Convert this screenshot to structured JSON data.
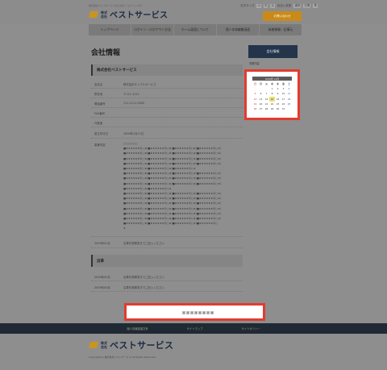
{
  "header": {
    "tagline": "株式会社ベストサービスの公式ホームページです",
    "logo_small": "株式会社",
    "logo_text": "ベストサービス",
    "util_label": "文字サイズ",
    "util_sizes": [
      "小",
      "中",
      "大"
    ],
    "util_print": "色合い変更",
    "util_colors": [
      "通常",
      "白黒",
      "青"
    ],
    "inquiry_button": "お問い合わせ"
  },
  "nav": {
    "items": [
      "トップページ",
      "ログイン・ログアウト方法",
      "ホーム画面について",
      "個人本体編集画面",
      "新着情報・記事元"
    ]
  },
  "main": {
    "page_title": "会社情報",
    "company_heading": "株式会社ベストサービス",
    "rows": [
      {
        "label": "会社名",
        "value": "株式会社サンプルサービス"
      },
      {
        "label": "所在地",
        "value": "〒111-1111"
      },
      {
        "label": "電話番号",
        "value": "111-1111-0000"
      },
      {
        "label": "FAX番号",
        "value": ""
      },
      {
        "label": "代表者",
        "value": ""
      },
      {
        "label": "設立年月日",
        "value": "2009年1月11日"
      }
    ],
    "business_label": "事業内容",
    "business_lines": [
      "□□□□□□",
      "■★★★★★★の□★/■★★★★★★の□★/■★★★★★★の□★/■★★★★★★の□★/",
      "■★★★★★★の□★/■★★★★★★の□★/■★★★★★★の□★/■★★★★★★の□★/",
      "■★★★★★★の□★/■★★★★★★の□★/■★★★★★★の□★/■★★★★★★の□★/",
      "■★★★★★★の□★/■★★★★★★の□★/■★★★★★★の□★/■★★★★★★の□★/",
      "■★★★★★★の□★/■★★★★★★の□★/■★★★★★★の□★",
      "■★★★★★★の□★/■★★★★★★の□★/■★★★★★★の□★/■★★★★★★の□★/",
      "■★★★★★★の□★/■★★★★★★の□★/■★★★★★★の□★/■★★★★★★の□★/",
      "■★★★★★★の□★/■★★★★★★の□★/■★★★★★★の□★/■★★★★★★の□★/",
      "■★★★★★★の□★/■★★★★★★の□★",
      "■★★★★★★の□★/■★★★★★★の□★/■★★★★★★の□★/■★★★★★★の□★/",
      "■★★★★★★の□★/■★★★★★★の□★/■★★★★★★の□★/■★★★★★★の□★/",
      "■★★★★★★の□★/■★★★★★★の□★/■★★★★★★の□★/■★★★★★★の□★/",
      "■★★★★★★の□★/■★★★★★★の□★/■★★★★★★の□★/■★★★★★★の□★/",
      "■★★★★★★の□★/■★★★★★★の□★/■★★★★★★の□★/■★★★★★★の□★/",
      "■★★★★★★の□★/■★★★★★★の□★/■★★★★★★の□★/■★★★★★★の□★/",
      "■★★★★★★の□★/■★★★★★★の□★/■★★★★★★の□★/■★★★★★★の□",
      "★"
    ],
    "history_row": {
      "label": "2009年01月",
      "value": "沿革を簡単書きでご記入ください"
    },
    "history_heading": "沿革",
    "history_rows": [
      {
        "label": "2009年02月",
        "value": "沿革を簡単書きでご記入ください"
      },
      {
        "label": "2009年03月",
        "value": "沿革を簡単書きでご記入ください"
      }
    ]
  },
  "sidebar": {
    "heading": "会社情報",
    "link": "事業内容"
  },
  "calendar": {
    "month_label": "2010年 12月",
    "weekdays": [
      "日",
      "月",
      "火",
      "水",
      "木",
      "金",
      "土"
    ],
    "days": [
      "",
      "",
      "",
      "1",
      "2",
      "3",
      "4",
      "5",
      "6",
      "7",
      "8",
      "9",
      "10",
      "11",
      "12",
      "13",
      "14",
      "15",
      "16",
      "17",
      "18",
      "19",
      "20",
      "21",
      "22",
      "23",
      "24",
      "25",
      "26",
      "27",
      "28",
      "29",
      "30",
      "31",
      ""
    ],
    "today": "15"
  },
  "pager": {
    "pages": [
      "1",
      "2",
      "3",
      "4",
      "5",
      "6",
      "7",
      "8"
    ]
  },
  "footer": {
    "links": [
      "個人情報保護方針",
      "サイトマップ",
      "サイトポリシー"
    ],
    "logo_small": "株式会社",
    "logo_text": "ベストサービス",
    "copyright": "Copyright(c) 株式会社ベストサービス All Rights Reserved."
  },
  "colors": {
    "highlight_border": "#e23b2f",
    "footer_nav_bg": "#1f2a35",
    "sidebar_head_bg": "#24344b",
    "inquiry_bg": "#c98a18"
  }
}
